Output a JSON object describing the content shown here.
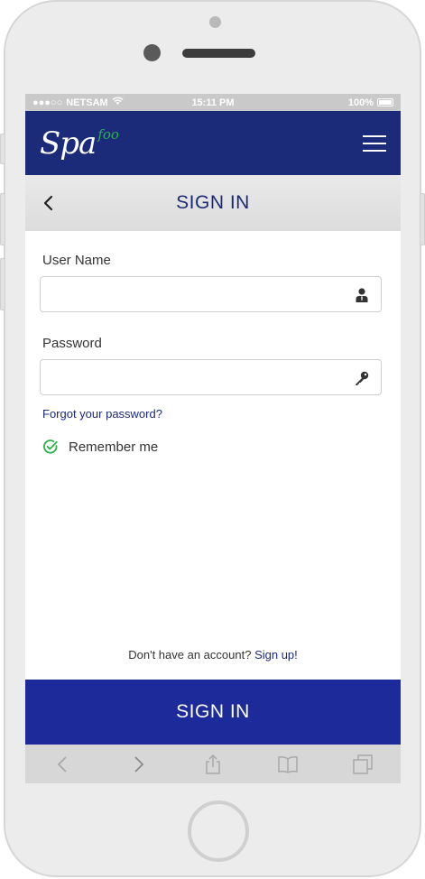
{
  "status_bar": {
    "carrier": "NETSAM",
    "time": "15:11 PM",
    "battery": "100%"
  },
  "header": {
    "logo_main": "Spa",
    "logo_sub": "foo",
    "menu_icon": "hamburger-icon"
  },
  "title_bar": {
    "title": "SIGN IN",
    "back_icon": "chevron-left-icon"
  },
  "form": {
    "username_label": "User Name",
    "username_value": "",
    "username_icon": "user-icon",
    "password_label": "Password",
    "password_value": "",
    "password_icon": "key-icon",
    "forgot_link": "Forgot your password?",
    "remember_label": "Remember me",
    "remember_checked": true
  },
  "footer": {
    "signup_prompt": "Don't have an account?",
    "signup_link": "Sign up!",
    "signin_button": "SIGN IN"
  },
  "browser_bar": {
    "icons": [
      "back-icon",
      "forward-icon",
      "share-icon",
      "bookmarks-icon",
      "tabs-icon"
    ]
  },
  "colors": {
    "primary": "#1c2a7a",
    "button": "#1c2a9a",
    "accent_green": "#2bb34a"
  }
}
